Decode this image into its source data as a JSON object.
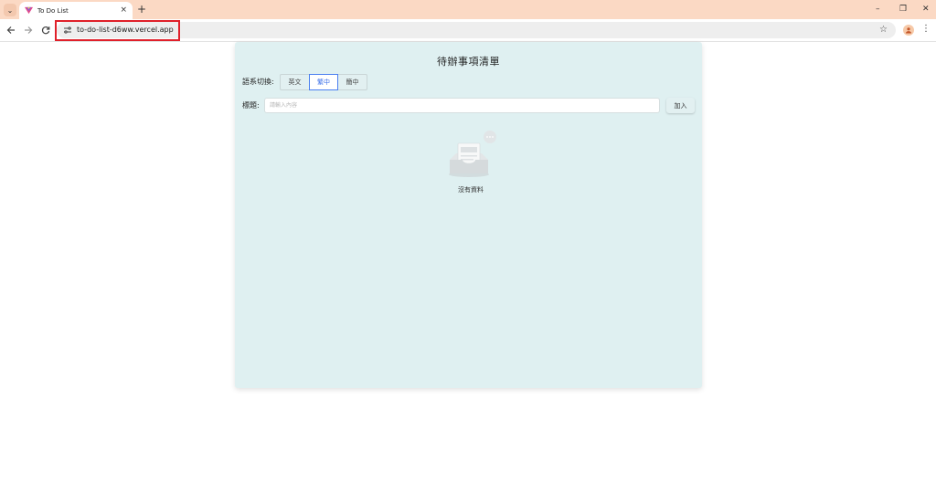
{
  "browser": {
    "tab_title": "To Do List",
    "new_tab": "+",
    "tab_close": "×",
    "url": "to-do-list-d6ww.vercel.app",
    "icons": {
      "tab_list": "chevron-down-icon",
      "back": "arrow-left-icon",
      "forward": "arrow-right-icon",
      "reload": "reload-icon",
      "site_info": "tune-icon",
      "bookmark": "star-icon",
      "profile": "profile-icon",
      "menu": "kebab-menu-icon"
    },
    "window_controls": {
      "minimize": "–",
      "restore": "❐",
      "close": "✕"
    },
    "colors": {
      "tabbar": "#fbd9c4",
      "highlight": "#e0202a"
    }
  },
  "app": {
    "title": "待辦事項清單",
    "lang_label": "語系切換:",
    "lang_options": [
      "英文",
      "繁中",
      "簡中"
    ],
    "lang_selected": "繁中",
    "title_label": "標題:",
    "input_value": "",
    "input_placeholder": "請輸入內容",
    "add_label": "加入",
    "empty_text": "沒有資料",
    "colors": {
      "card_bg": "#dff0f1",
      "accent": "#3a6fe8"
    }
  }
}
